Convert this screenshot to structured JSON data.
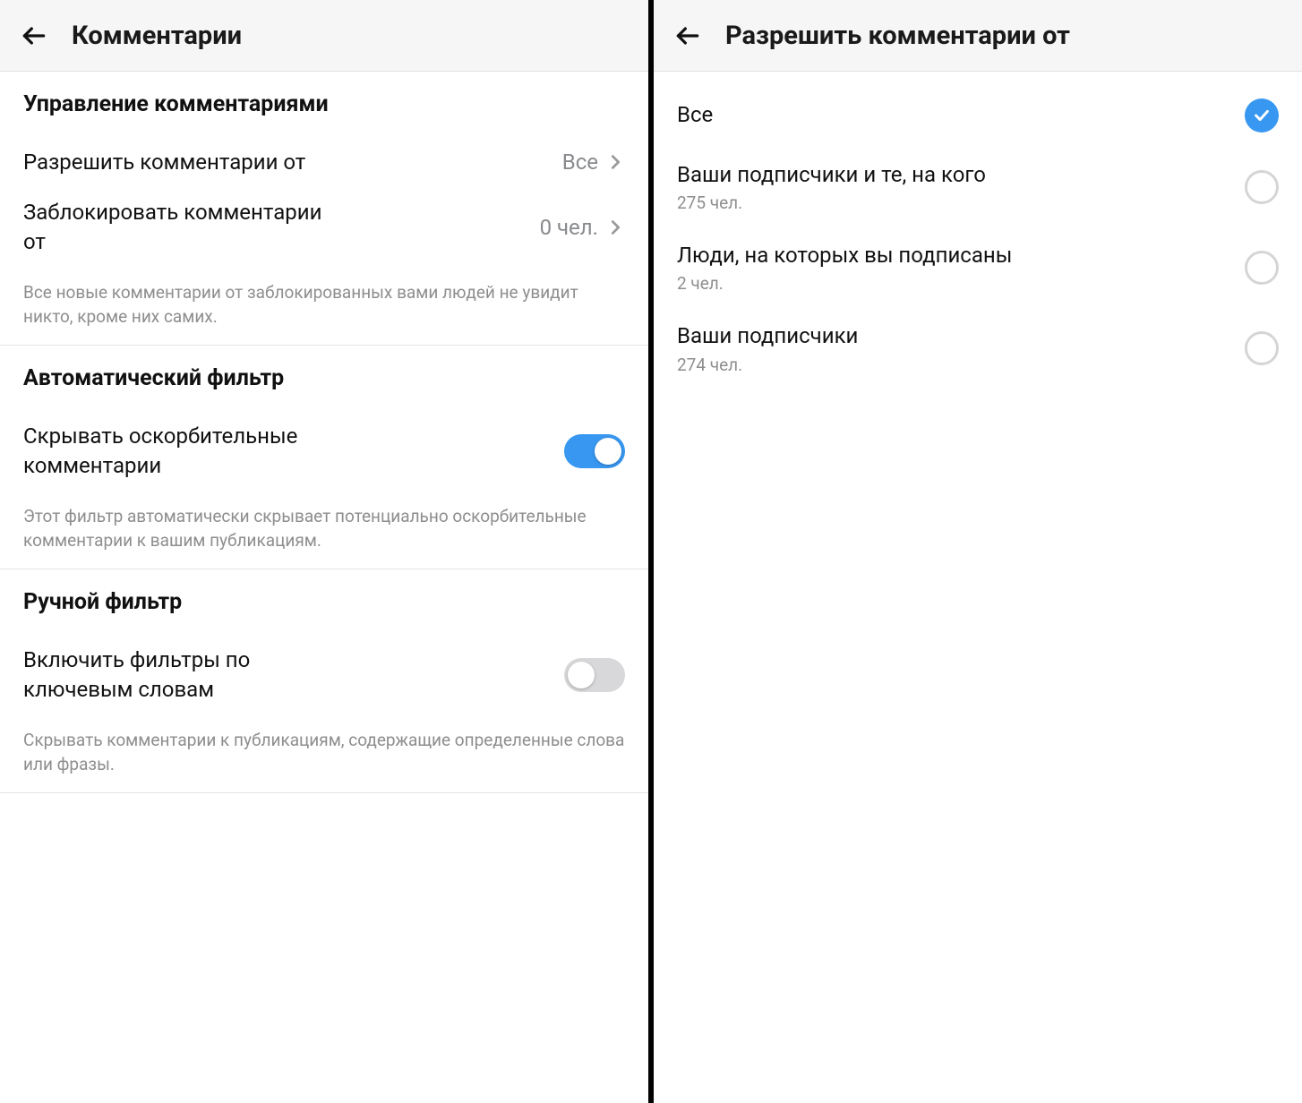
{
  "left": {
    "header_title": "Комментарии",
    "sections": {
      "controls": {
        "title": "Управление комментариями",
        "allow_from": {
          "label": "Разрешить комментарии от",
          "value": "Все"
        },
        "block_from": {
          "label": "Заблокировать комментарии от",
          "value": "0 чел."
        },
        "desc": "Все новые комментарии от заблокированных вами людей не увидит никто, кроме них самих."
      },
      "auto_filter": {
        "title": "Автоматический фильтр",
        "hide_offensive": {
          "label": "Скрывать оскорбительные комментарии",
          "enabled": true
        },
        "desc": "Этот фильтр автоматически скрывает потенциально оскорбительные комментарии к вашим публикациям."
      },
      "manual_filter": {
        "title": "Ручной фильтр",
        "keyword_filter": {
          "label": "Включить фильтры по ключевым словам",
          "enabled": false
        },
        "desc": "Скрывать комментарии к публикациям, содержащие определенные слова или фразы."
      }
    }
  },
  "right": {
    "header_title": "Разрешить комментарии от",
    "options": [
      {
        "label": "Все",
        "sub": "",
        "selected": true
      },
      {
        "label": "Ваши подписчики и те, на кого",
        "sub": "275 чел.",
        "selected": false
      },
      {
        "label": "Люди, на которых вы подписаны",
        "sub": "2 чел.",
        "selected": false
      },
      {
        "label": "Ваши подписчики",
        "sub": "274 чел.",
        "selected": false
      }
    ]
  }
}
